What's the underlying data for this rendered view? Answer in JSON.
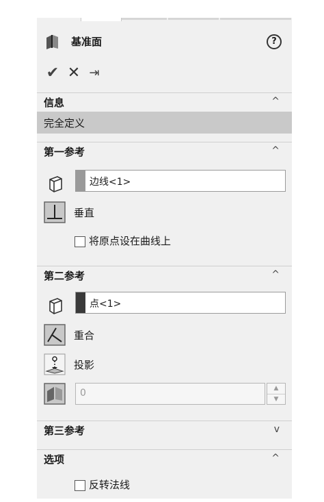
{
  "panel": {
    "title": "基准面",
    "help_symbol": "?",
    "actions": {
      "ok": "✔",
      "cancel": "✕",
      "pin": "⇥"
    }
  },
  "sections": {
    "info": {
      "title": "信息",
      "chevron": "^",
      "message": "完全定义"
    },
    "first_ref": {
      "title": "第一参考",
      "chevron": "^",
      "selection": "边线<1>",
      "swatch_color": "#9a9a9a",
      "constraint": "垂直",
      "checkbox_label": "将原点设在曲线上"
    },
    "second_ref": {
      "title": "第二参考",
      "chevron": "^",
      "selection": "点<1>",
      "swatch_color": "#3a3a3a",
      "constraint_1": "重合",
      "constraint_2": "投影",
      "distance_value": "0"
    },
    "third_ref": {
      "title": "第三参考",
      "chevron": "v"
    },
    "options": {
      "title": "选项",
      "chevron": "^",
      "checkbox_label": "反转法线"
    }
  }
}
